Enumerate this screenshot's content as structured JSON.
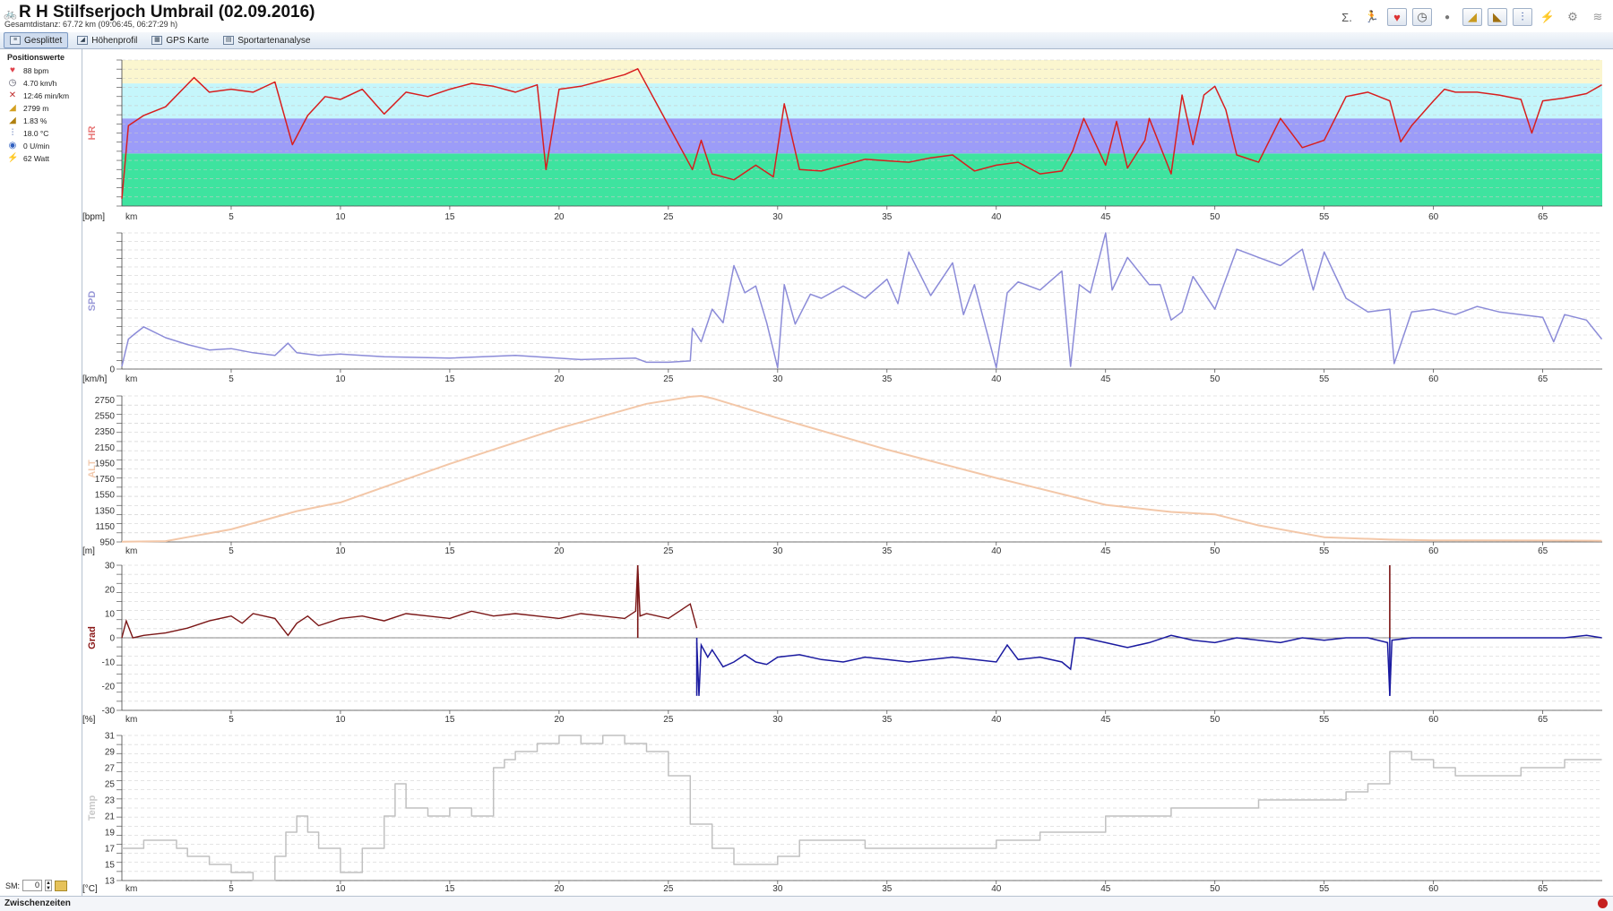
{
  "window": {
    "title": "R H Stilfserjoch Umbrail (02.09.2016)",
    "subtitle": "Gesamtdistanz: 67.72 km (09:06:45, 06:27:29 h)"
  },
  "toolbar": {
    "icons": [
      "sigma-icon",
      "runner-icon",
      "heart-icon",
      "clock-icon",
      "dot-icon",
      "ascent-icon",
      "slope-icon",
      "thermometer-icon",
      "lightning-icon",
      "cyclist-icon",
      "wind-icon"
    ],
    "sigma_glyph": "Σ.",
    "runner_glyph": "🏃",
    "heart_glyph": "♥",
    "clock_glyph": "◷",
    "dot_glyph": "●",
    "ascent_glyph": "◢",
    "slope_glyph": "◣",
    "thermo_glyph": "⫶",
    "lightning_glyph": "⚡",
    "cyclist_glyph": "⚙",
    "wind_glyph": "≋"
  },
  "tabs": [
    {
      "label": "Gesplittet",
      "active": true
    },
    {
      "label": "Höhenprofil",
      "active": false
    },
    {
      "label": "GPS Karte",
      "active": false
    },
    {
      "label": "Sportartenanalyse",
      "active": false
    }
  ],
  "sidebar": {
    "title": "Positionswerte",
    "items": [
      {
        "icon": "heart-icon",
        "glyph": "♥",
        "color": "#e0404a",
        "value": "88 bpm"
      },
      {
        "icon": "speedometer-icon",
        "glyph": "◷",
        "color": "#556",
        "value": "4.70 km/h"
      },
      {
        "icon": "runner-icon",
        "glyph": "✕",
        "color": "#c03030",
        "value": "12:46 min/km"
      },
      {
        "icon": "altitude-icon",
        "glyph": "◢",
        "color": "#d4a020",
        "value": "2799 m"
      },
      {
        "icon": "gradient-icon",
        "glyph": "◢",
        "color": "#b08010",
        "value": "1.83 %"
      },
      {
        "icon": "thermometer-icon",
        "glyph": "⫶",
        "color": "#3050a0",
        "value": "18.0 °C"
      },
      {
        "icon": "cadence-icon",
        "glyph": "◉",
        "color": "#3060c0",
        "value": "0 U/min"
      },
      {
        "icon": "power-icon",
        "glyph": "⚡",
        "color": "#e0a010",
        "value": "62 Watt"
      }
    ],
    "sm_label": "SM:",
    "sm_value": "0"
  },
  "statusbar": {
    "label": "Zwischenzeiten"
  },
  "chart_data": [
    {
      "type": "line",
      "ylabel": "HR",
      "unit": "[bpm]",
      "color": "#d81e1e",
      "label_color": "#e87a7a",
      "zones": [
        {
          "from": 0,
          "to": 0.36,
          "color": "#3ee39f"
        },
        {
          "from": 0.36,
          "to": 0.6,
          "color": "#9c9cf8"
        },
        {
          "from": 0.6,
          "to": 0.84,
          "color": "#c5f6fb"
        },
        {
          "from": 0.84,
          "to": 1.0,
          "color": "#fbf6cf"
        }
      ],
      "ylim": [
        0,
        1
      ],
      "yticks": [],
      "x": [
        0,
        0.3,
        1,
        2,
        3.3,
        4,
        5,
        6,
        7,
        7.8,
        8.5,
        9.3,
        10,
        11,
        12,
        13,
        14,
        15,
        16,
        17,
        18,
        19,
        19.4,
        20,
        21,
        22,
        23,
        23.6,
        26.1,
        26.5,
        27,
        28,
        29,
        29.8,
        30.3,
        31,
        32,
        33,
        34,
        35,
        36,
        37,
        38,
        39,
        40,
        41,
        42,
        43,
        43.5,
        44,
        45,
        45.5,
        46,
        46.8,
        47,
        48,
        48.5,
        49,
        49.5,
        50,
        50.5,
        51,
        52,
        53,
        54,
        55,
        56,
        57,
        58,
        58.5,
        59,
        60,
        60.5,
        61,
        62,
        63,
        64,
        64.5,
        65,
        66,
        67,
        67.7
      ],
      "values": [
        0.05,
        0.55,
        0.62,
        0.68,
        0.88,
        0.78,
        0.8,
        0.78,
        0.85,
        0.42,
        0.62,
        0.75,
        0.73,
        0.8,
        0.63,
        0.78,
        0.75,
        0.8,
        0.84,
        0.82,
        0.78,
        0.83,
        0.25,
        0.8,
        0.82,
        0.86,
        0.9,
        0.94,
        0.25,
        0.45,
        0.22,
        0.18,
        0.28,
        0.2,
        0.7,
        0.25,
        0.24,
        0.28,
        0.32,
        0.31,
        0.3,
        0.33,
        0.35,
        0.24,
        0.28,
        0.3,
        0.22,
        0.24,
        0.38,
        0.6,
        0.28,
        0.58,
        0.26,
        0.45,
        0.6,
        0.22,
        0.76,
        0.42,
        0.76,
        0.82,
        0.66,
        0.35,
        0.3,
        0.6,
        0.4,
        0.45,
        0.75,
        0.78,
        0.72,
        0.44,
        0.55,
        0.72,
        0.8,
        0.78,
        0.78,
        0.76,
        0.73,
        0.5,
        0.72,
        0.74,
        0.77,
        0.83
      ]
    },
    {
      "type": "line",
      "ylabel": "SPD",
      "unit": "[km/h]",
      "color": "#8b8bd8",
      "label_color": "#9a9ad8",
      "ylim": [
        0,
        100
      ],
      "yticks": [
        0
      ],
      "x": [
        0,
        0.3,
        0.6,
        1,
        2,
        3,
        4,
        5,
        6,
        7,
        7.6,
        8,
        9,
        10,
        12,
        15,
        18,
        21,
        23.5,
        24,
        25,
        26,
        26.1,
        26.5,
        27,
        27.5,
        28,
        28.5,
        29,
        29.5,
        30,
        30.3,
        30.8,
        31.5,
        32,
        33,
        34,
        35,
        35.5,
        36,
        37,
        38,
        38.5,
        39,
        40,
        40.5,
        41,
        42,
        43,
        43.4,
        43.8,
        44.3,
        45,
        45.3,
        46,
        47,
        47.5,
        48,
        48.5,
        49,
        50,
        51,
        52,
        53,
        54,
        54.5,
        55,
        56,
        57,
        58,
        58.2,
        59,
        60,
        61,
        62,
        63,
        64,
        65,
        65.5,
        66,
        67,
        67.7
      ],
      "values": [
        2,
        22,
        26,
        31,
        23,
        18,
        14,
        15,
        12,
        10,
        19,
        12,
        10,
        11,
        9,
        8,
        10,
        7,
        8,
        5,
        5,
        6,
        30,
        20,
        44,
        34,
        76,
        56,
        61,
        34,
        1,
        62,
        33,
        55,
        52,
        61,
        52,
        66,
        48,
        86,
        54,
        78,
        40,
        62,
        1,
        56,
        64,
        58,
        72,
        2,
        62,
        56,
        100,
        58,
        82,
        62,
        62,
        36,
        42,
        68,
        44,
        88,
        82,
        76,
        88,
        58,
        86,
        52,
        42,
        44,
        4,
        42,
        44,
        40,
        46,
        42,
        40,
        38,
        20,
        40,
        36,
        22
      ]
    },
    {
      "type": "line",
      "ylabel": "ALT",
      "unit": "[m]",
      "color": "#f3c7a8",
      "label_color": "#f2c9ad",
      "ylim": [
        950,
        2800
      ],
      "yticks": [
        950,
        1150,
        1350,
        1550,
        1750,
        1950,
        2150,
        2350,
        2550,
        2750
      ],
      "x": [
        0,
        2,
        3,
        5,
        8,
        10,
        15,
        20,
        24,
        26,
        26.5,
        27,
        30,
        35,
        40,
        45,
        48,
        50,
        52,
        55,
        58,
        60,
        65,
        67.7
      ],
      "values": [
        952,
        960,
        1010,
        1110,
        1340,
        1450,
        1940,
        2390,
        2700,
        2790,
        2800,
        2770,
        2520,
        2120,
        1760,
        1420,
        1330,
        1300,
        1160,
        1010,
        980,
        970,
        968,
        965
      ]
    },
    {
      "type": "line",
      "ylabel": "Grad",
      "unit": "[%]",
      "colors": {
        "up": "#7a1515",
        "down": "#1a1aa0"
      },
      "label_color": "#8a1818",
      "ylim": [
        -30,
        30
      ],
      "yticks": [
        -30,
        -20,
        -10,
        0,
        10,
        20,
        30
      ],
      "up_x": [
        0,
        0.2,
        0.5,
        1,
        2,
        3,
        4,
        5,
        5.5,
        6,
        7,
        7.6,
        8,
        8.5,
        9,
        10,
        11,
        12,
        13,
        14,
        15,
        16,
        17,
        18,
        19,
        20,
        21,
        22,
        23,
        23.5,
        23.6,
        23.7,
        24,
        25,
        25.5,
        26,
        26.3
      ],
      "up_values": [
        0,
        7,
        0,
        1,
        2,
        4,
        7,
        9,
        6,
        10,
        8,
        1,
        6,
        9,
        5,
        8,
        9,
        7,
        10,
        9,
        8,
        11,
        9,
        10,
        9,
        8,
        10,
        9,
        8,
        11,
        30,
        9,
        10,
        8,
        11,
        14,
        4
      ],
      "down_x": [
        26.3,
        26.4,
        26.5,
        26.8,
        27,
        27.5,
        28,
        28.5,
        29,
        29.5,
        30,
        31,
        32,
        33,
        34,
        35,
        36,
        37,
        38,
        39,
        40,
        40.5,
        41,
        42,
        43,
        43.4,
        43.6,
        44,
        45,
        46,
        47,
        48,
        49,
        50,
        51,
        52,
        53,
        54,
        55,
        56,
        57,
        57.9,
        58,
        58.1,
        59,
        60,
        61,
        62,
        63,
        64,
        65,
        66,
        67,
        67.7
      ],
      "down_values": [
        -2,
        -24,
        -3,
        -8,
        -5,
        -12,
        -10,
        -7,
        -10,
        -11,
        -8,
        -7,
        -9,
        -10,
        -8,
        -9,
        -10,
        -9,
        -8,
        -9,
        -10,
        -3,
        -9,
        -8,
        -10,
        -13,
        0,
        0,
        -2,
        -4,
        -2,
        1,
        -1,
        -2,
        0,
        -1,
        -2,
        0,
        -1,
        0,
        0,
        -2,
        -24,
        -1,
        0,
        0,
        0,
        0,
        0,
        0,
        0,
        0,
        1,
        0
      ],
      "spikes": [
        {
          "x": 23.6,
          "from": 0,
          "to": 30
        },
        {
          "x": 58,
          "from": 0,
          "to": 30
        },
        {
          "x": 58,
          "from": 0,
          "to": -24
        },
        {
          "x": 26.3,
          "from": 0,
          "to": -24
        }
      ]
    },
    {
      "type": "line",
      "step": true,
      "ylabel": "Temp",
      "unit": "[°C]",
      "color": "#c0c0c0",
      "label_color": "#c8c8c8",
      "ylim": [
        13,
        31
      ],
      "yticks": [
        13,
        15,
        17,
        19,
        21,
        23,
        25,
        27,
        29,
        31
      ],
      "x": [
        0,
        0.8,
        1,
        2,
        2.5,
        3,
        4,
        5,
        6,
        6.5,
        7,
        7.5,
        8,
        8.5,
        9,
        10,
        11,
        12,
        12.5,
        13,
        14,
        15,
        16,
        17,
        17.5,
        18,
        19,
        20,
        21,
        22,
        23,
        24,
        25,
        26,
        27,
        28,
        29,
        30,
        31,
        32,
        33,
        34,
        35,
        36,
        37,
        38,
        39,
        40,
        42,
        45,
        48,
        50,
        52,
        55,
        56,
        57,
        58,
        59,
        60,
        61,
        62,
        63,
        64,
        65,
        66,
        67,
        67.7
      ],
      "values": [
        17,
        17,
        18,
        18,
        17,
        16,
        15,
        14,
        13,
        13,
        16,
        19,
        21,
        19,
        17,
        14,
        17,
        21,
        25,
        22,
        21,
        22,
        21,
        27,
        28,
        29,
        30,
        31,
        30,
        31,
        30,
        29,
        26,
        20,
        17,
        15,
        15,
        16,
        18,
        18,
        18,
        17,
        17,
        17,
        17,
        17,
        17,
        18,
        19,
        21,
        22,
        22,
        23,
        23,
        24,
        25,
        29,
        28,
        27,
        26,
        26,
        26,
        27,
        27,
        28,
        28,
        28
      ]
    }
  ],
  "x_axis": {
    "label": "km",
    "max": 67.72,
    "ticks": [
      5,
      10,
      15,
      20,
      25,
      30,
      35,
      40,
      45,
      50,
      55,
      60,
      65
    ]
  }
}
